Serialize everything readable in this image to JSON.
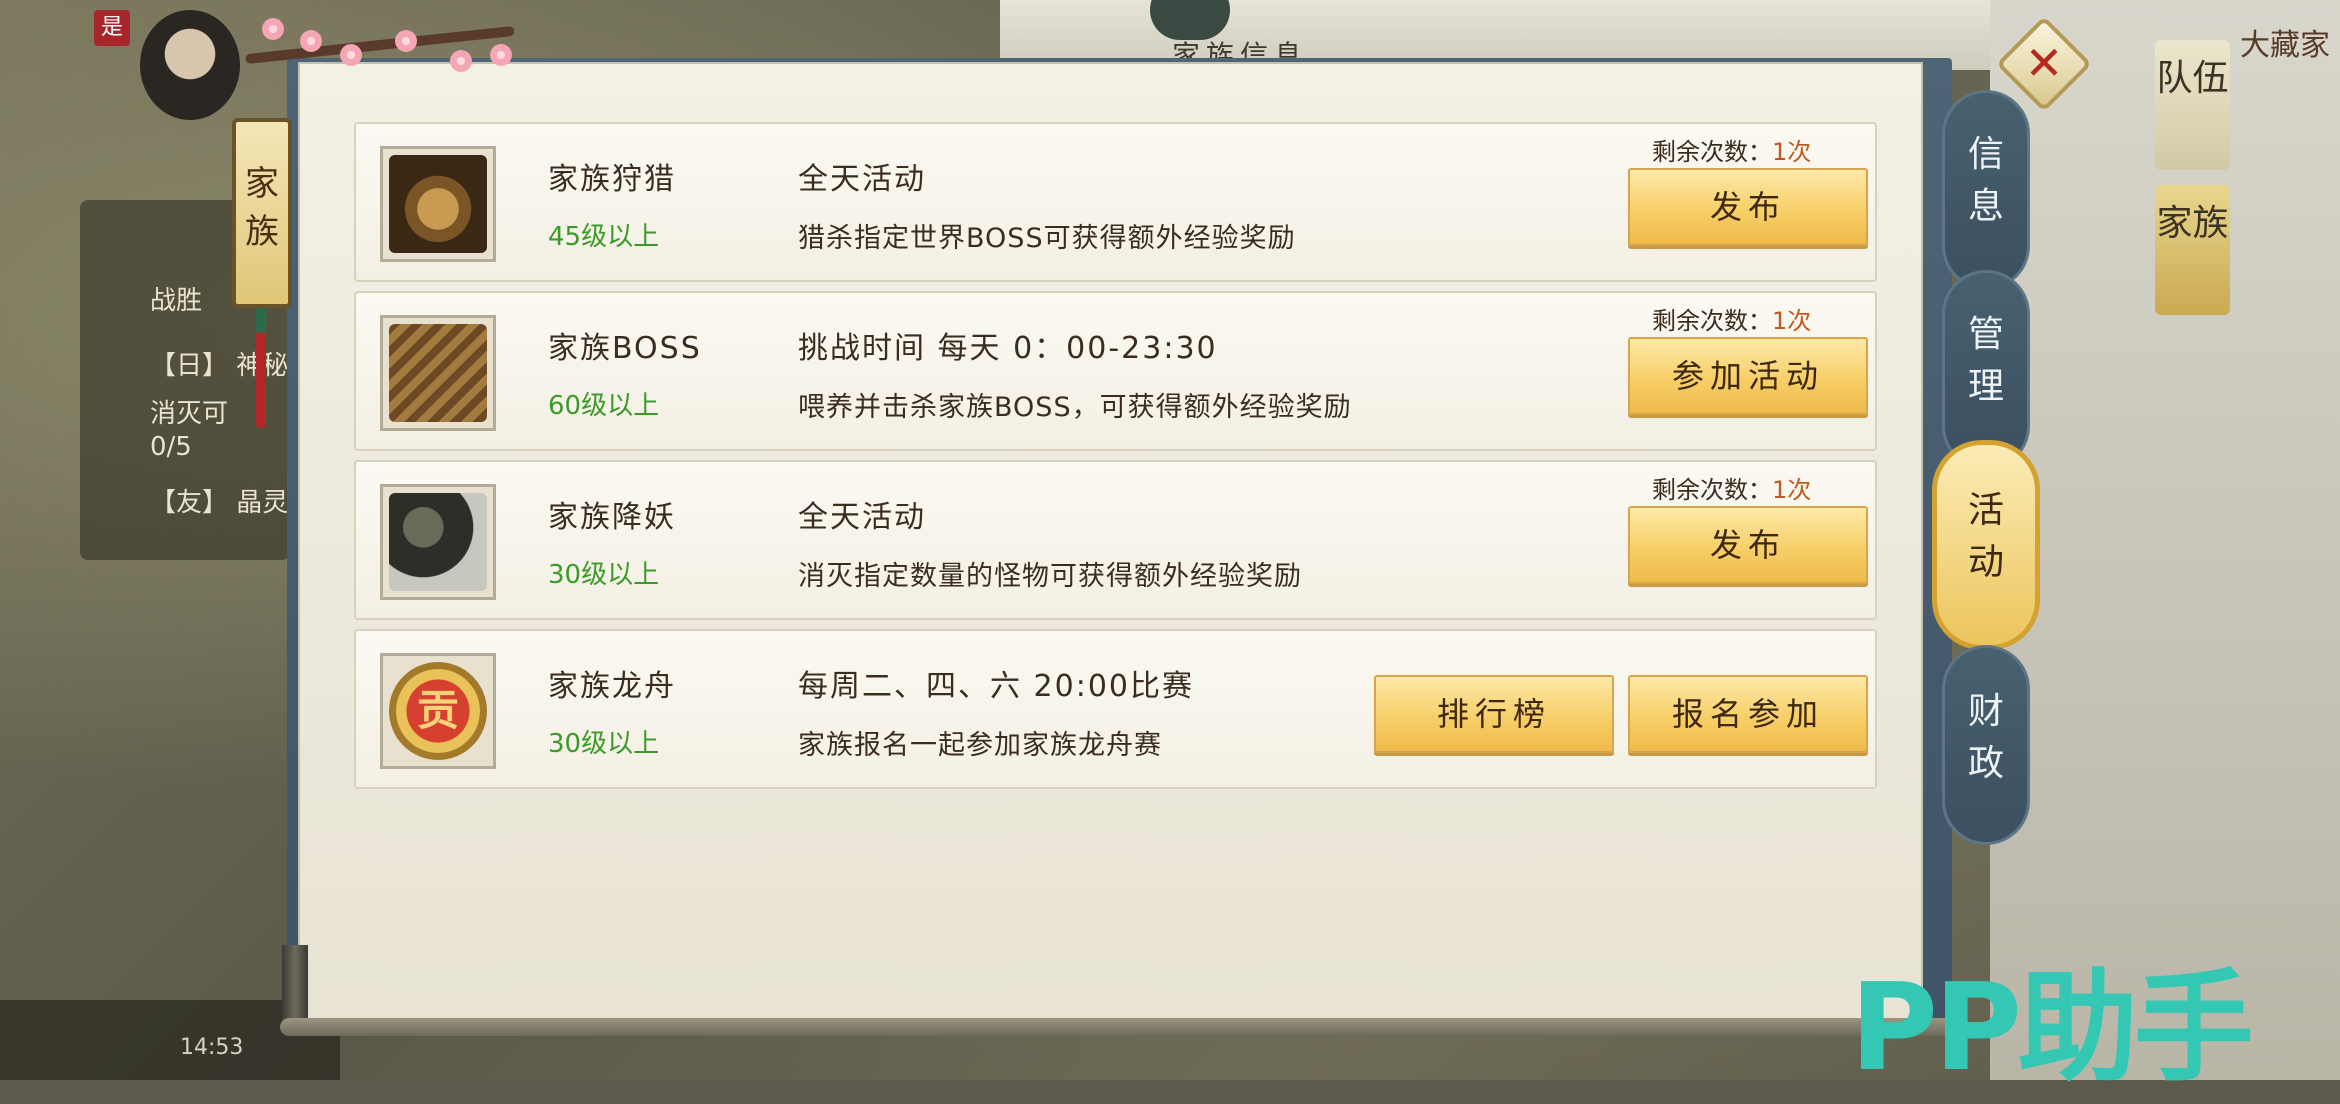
{
  "background": {
    "top_text": "家族信息",
    "corner_text": "大藏家",
    "badge": "是",
    "left_lines": [
      "战胜",
      "【日】 神秘",
      "消灭可",
      "0/5",
      "【友】 晶灵"
    ],
    "right_tabs": [
      "队伍",
      "家族"
    ],
    "bottom_text": "14:53"
  },
  "left_tag": {
    "label": "家族"
  },
  "close_button": {
    "icon": "close-x-icon"
  },
  "side_tabs": [
    {
      "label": "信息",
      "active": false
    },
    {
      "label": "管理",
      "active": false
    },
    {
      "label": "活动",
      "active": true
    },
    {
      "label": "财政",
      "active": false
    }
  ],
  "activities": [
    {
      "icon": "monster-horned-head-icon",
      "name": "家族狩猎",
      "level": "45级以上",
      "time": "全天活动",
      "desc": "猎杀指定世界BOSS可获得额外经验奖励",
      "remaining_label": "剩余次数：",
      "remaining_value": "1次",
      "buttons": [
        "发布"
      ]
    },
    {
      "icon": "dragon-boss-icon",
      "name": "家族BOSS",
      "level": "60级以上",
      "time": "挑战时间 每天 0：00-23:30",
      "desc": "喂养并击杀家族BOSS，可获得额外经验奖励",
      "remaining_label": "剩余次数：",
      "remaining_value": "1次",
      "buttons": [
        "参加活动"
      ]
    },
    {
      "icon": "skeleton-warrior-icon",
      "name": "家族降妖",
      "level": "30级以上",
      "time": "全天活动",
      "desc": "消灭指定数量的怪物可获得额外经验奖励",
      "remaining_label": "剩余次数：",
      "remaining_value": "1次",
      "buttons": [
        "发布"
      ]
    },
    {
      "icon": "tribute-medal-icon",
      "icon_text": "贡",
      "name": "家族龙舟",
      "level": "30级以上",
      "time": "每周二、四、六 20:00比赛",
      "desc": "家族报名一起参加家族龙舟赛",
      "buttons": [
        "排行榜",
        "报名参加"
      ]
    }
  ],
  "watermark": "PP助手",
  "colors": {
    "level_green": "#3d9a2a",
    "remaining_orange": "#c1581f",
    "button_gold": "#f7cf68",
    "tab_active": "#ecc55c",
    "tab_inactive": "#486070",
    "watermark": "#34c8b4"
  }
}
